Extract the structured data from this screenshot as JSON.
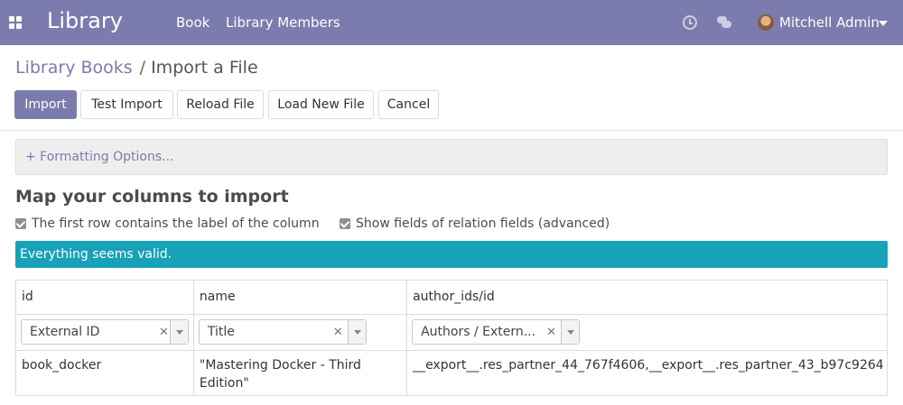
{
  "navbar": {
    "brand": "Library",
    "menu": [
      "Book",
      "Library Members"
    ],
    "user_name": "Mitchell Admin",
    "bg_color": "#7c7bad"
  },
  "breadcrumb": {
    "parent": "Library Books",
    "separator": "/",
    "current": "Import a File"
  },
  "toolbar": {
    "import_label": "Import",
    "test_import_label": "Test Import",
    "reload_label": "Reload File",
    "load_new_label": "Load New File",
    "cancel_label": "Cancel"
  },
  "formatting_options_label": "+ Formatting Options...",
  "section_title": "Map your columns to import",
  "checkboxes": {
    "first_row_label": "The first row contains the label of the column",
    "first_row_checked": true,
    "relation_fields_label": "Show fields of relation fields (advanced)",
    "relation_fields_checked": true
  },
  "alert": {
    "message": "Everything seems valid.",
    "color": "#17a2b8"
  },
  "table": {
    "headers": [
      "id",
      "name",
      "author_ids/id"
    ],
    "mappings": [
      "External ID",
      "Title",
      "Authors / Extern..."
    ],
    "rows": [
      [
        "book_docker",
        "\"Mastering Docker - Third Edition\"",
        "__export__.res_partner_44_767f4606,__export__.res_partner_43_b97c9264"
      ]
    ]
  }
}
